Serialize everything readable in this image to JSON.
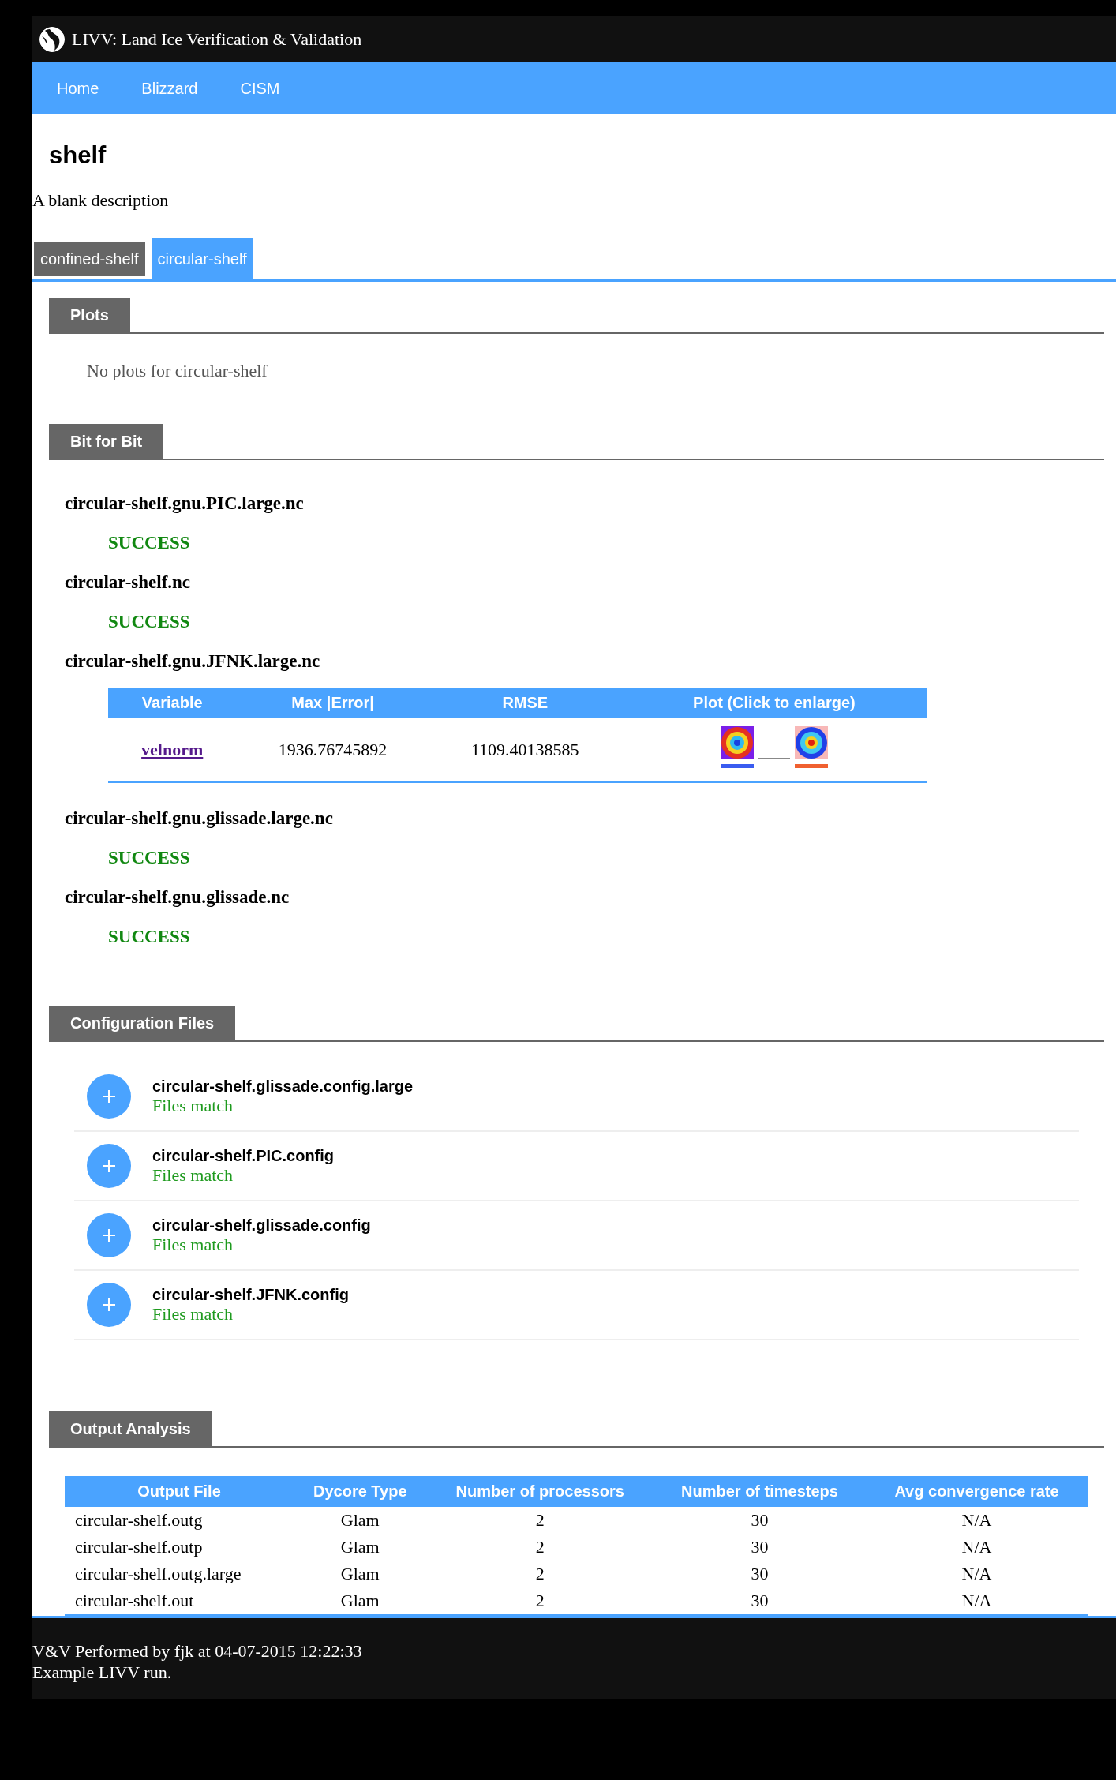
{
  "header": {
    "title": "LIVV: Land Ice Verification & Validation"
  },
  "nav": [
    {
      "label": "Home"
    },
    {
      "label": "Blizzard"
    },
    {
      "label": "CISM"
    }
  ],
  "page": {
    "title": "shelf",
    "description": "A blank description"
  },
  "tabs": [
    {
      "label": "confined-shelf",
      "selected": false
    },
    {
      "label": "circular-shelf",
      "selected": true
    }
  ],
  "sections": [
    {
      "kind": "plots",
      "title": "Plots",
      "message": "No plots for circular-shelf"
    },
    {
      "kind": "bit_for_bit",
      "title": "Bit for Bit",
      "results": [
        {
          "kind": "status",
          "file": "circular-shelf.gnu.PIC.large.nc",
          "status": "SUCCESS"
        },
        {
          "kind": "status",
          "file": "circular-shelf.nc",
          "status": "SUCCESS"
        },
        {
          "kind": "table",
          "file": "circular-shelf.gnu.JFNK.large.nc",
          "table": {
            "columns": [
              "Variable",
              "Max |Error|",
              "RMSE",
              "Plot (Click to enlarge)"
            ],
            "rows": [
              {
                "variable": "velnorm",
                "max_error": "1936.76745892",
                "rmse": "1109.40138585"
              }
            ]
          }
        },
        {
          "kind": "status",
          "file": "circular-shelf.gnu.glissade.large.nc",
          "status": "SUCCESS"
        },
        {
          "kind": "status",
          "file": "circular-shelf.gnu.glissade.nc",
          "status": "SUCCESS"
        }
      ]
    },
    {
      "kind": "config",
      "title": "Configuration Files",
      "files": [
        {
          "name": "circular-shelf.glissade.config.large",
          "status": "Files match"
        },
        {
          "name": "circular-shelf.PIC.config",
          "status": "Files match"
        },
        {
          "name": "circular-shelf.glissade.config",
          "status": "Files match"
        },
        {
          "name": "circular-shelf.JFNK.config",
          "status": "Files match"
        }
      ]
    },
    {
      "kind": "output",
      "title": "Output Analysis",
      "table": {
        "columns": [
          "Output File",
          "Dycore Type",
          "Number of processors",
          "Number of timesteps",
          "Avg convergence rate"
        ],
        "rows": [
          [
            "circular-shelf.outg",
            "Glam",
            "2",
            "30",
            "N/A"
          ],
          [
            "circular-shelf.outp",
            "Glam",
            "2",
            "30",
            "N/A"
          ],
          [
            "circular-shelf.outg.large",
            "Glam",
            "2",
            "30",
            "N/A"
          ],
          [
            "circular-shelf.out",
            "Glam",
            "2",
            "30",
            "N/A"
          ]
        ]
      }
    }
  ],
  "footer": {
    "lines": [
      "V&V Performed by fjk at 04-07-2015 12:22:33",
      "Example LIVV run."
    ]
  }
}
